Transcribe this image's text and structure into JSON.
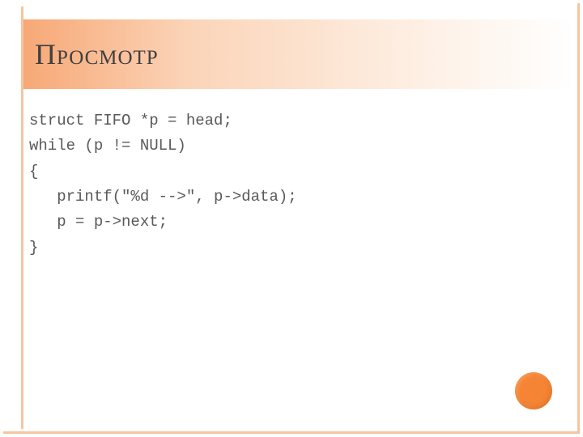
{
  "title": "Просмотр",
  "code": {
    "line1": "struct FIFO *p = head;",
    "line2": "while (p != NULL)",
    "line3": "{",
    "line4": "   printf(\"%d -->\", p->data);",
    "line5": "   p = p->next;",
    "line6": "}"
  }
}
